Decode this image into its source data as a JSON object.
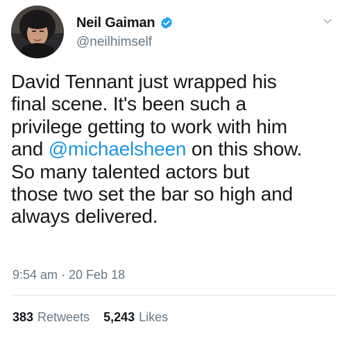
{
  "colors": {
    "text_primary": "#14171a",
    "text_secondary": "#657786",
    "link": "#1b95e0",
    "verified_badge": "#1da1f2",
    "divider": "#e1e8ed"
  },
  "author": {
    "display_name": "Neil Gaiman",
    "handle": "@neilhimself",
    "verified": true,
    "avatar_icon": "user-avatar-photo"
  },
  "tweet": {
    "lines": [
      {
        "text": "David Tennant just wrapped his"
      },
      {
        "text": "final scene.  It's been such a"
      },
      {
        "text": "privilege getting to work with him"
      },
      {
        "before": "and ",
        "mention": "@michaelsheen",
        "after": " on this show."
      },
      {
        "text": "So many talented actors but"
      },
      {
        "text": "those two set the bar so high and"
      },
      {
        "text": "always delivered."
      }
    ],
    "timestamp": "9:54 am · 20 Feb 18"
  },
  "stats": {
    "retweets_count": "383",
    "retweets_label": "Retweets",
    "likes_count": "5,243",
    "likes_label": "Likes"
  },
  "icons": {
    "verified": "verified-badge-icon",
    "menu": "chevron-down-icon"
  }
}
